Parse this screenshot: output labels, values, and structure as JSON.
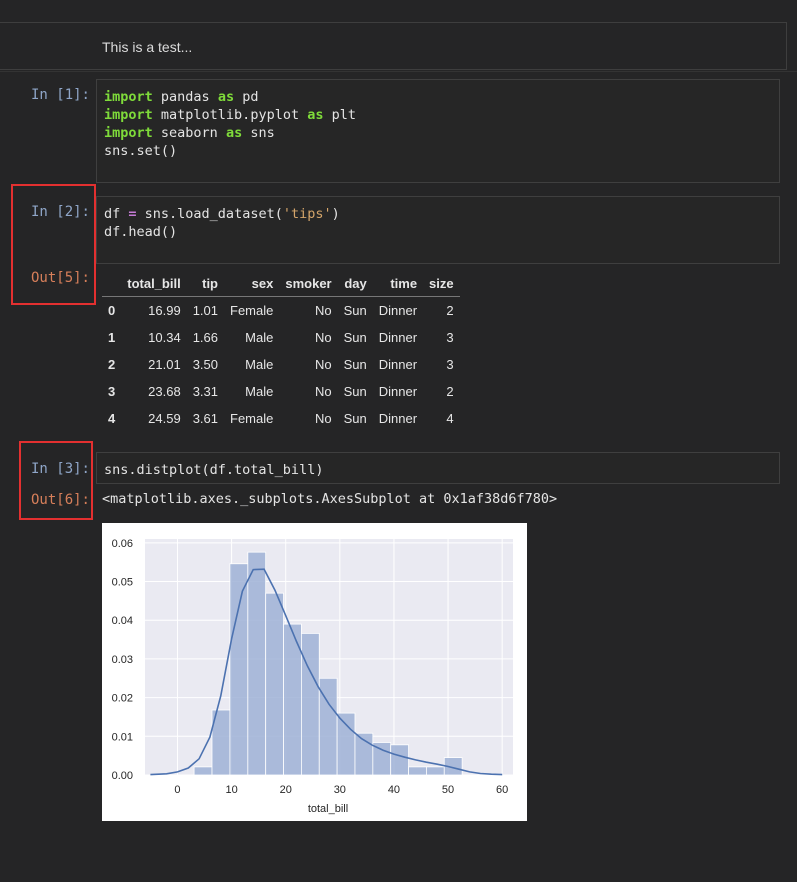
{
  "markdown": {
    "text": "This is a test..."
  },
  "cells": [
    {
      "in_prompt": "In [1]:",
      "lines": [
        [
          {
            "t": "import",
            "c": "kw"
          },
          {
            "t": " pandas "
          },
          {
            "t": "as",
            "c": "kw"
          },
          {
            "t": " pd"
          }
        ],
        [
          {
            "t": "import",
            "c": "kw"
          },
          {
            "t": " matplotlib.pyplot "
          },
          {
            "t": "as",
            "c": "kw"
          },
          {
            "t": " plt"
          }
        ],
        [
          {
            "t": "import",
            "c": "kw"
          },
          {
            "t": " seaborn "
          },
          {
            "t": "as",
            "c": "kw"
          },
          {
            "t": " sns"
          }
        ],
        [
          {
            "t": "sns.set()"
          }
        ]
      ]
    },
    {
      "in_prompt": "In [2]:",
      "out_prompt": "Out[5]:",
      "lines": [
        [
          {
            "t": "df "
          },
          {
            "t": "=",
            "c": "op"
          },
          {
            "t": " sns.load_dataset("
          },
          {
            "t": "'tips'",
            "c": "str"
          },
          {
            "t": ")"
          }
        ],
        [
          {
            "t": "df.head()"
          }
        ]
      ]
    },
    {
      "in_prompt": "In [3]:",
      "out_prompt": "Out[6]:",
      "lines": [
        [
          {
            "t": "sns.distplot(df.total_bill)"
          }
        ]
      ],
      "output_text": "<matplotlib.axes._subplots.AxesSubplot at 0x1af38d6f780>"
    }
  ],
  "dataframe": {
    "columns": [
      "",
      "total_bill",
      "tip",
      "sex",
      "smoker",
      "day",
      "time",
      "size"
    ],
    "rows": [
      [
        "0",
        "16.99",
        "1.01",
        "Female",
        "No",
        "Sun",
        "Dinner",
        "2"
      ],
      [
        "1",
        "10.34",
        "1.66",
        "Male",
        "No",
        "Sun",
        "Dinner",
        "3"
      ],
      [
        "2",
        "21.01",
        "3.50",
        "Male",
        "No",
        "Sun",
        "Dinner",
        "3"
      ],
      [
        "3",
        "23.68",
        "3.31",
        "Male",
        "No",
        "Sun",
        "Dinner",
        "2"
      ],
      [
        "4",
        "24.59",
        "3.61",
        "Female",
        "No",
        "Sun",
        "Dinner",
        "4"
      ]
    ]
  },
  "colors": {
    "highlight": "#e33030",
    "bar": "#9fb2d6",
    "kde": "#4c72b0",
    "plot_bg": "#eaeaf2"
  },
  "chart_data": {
    "type": "bar",
    "xlabel": "total_bill",
    "ylabel": "",
    "xlim": [
      -6,
      62
    ],
    "ylim": [
      0,
      0.061
    ],
    "xticks": [
      0,
      10,
      20,
      30,
      40,
      50,
      60
    ],
    "yticks": [
      0.0,
      0.01,
      0.02,
      0.03,
      0.04,
      0.05,
      0.06
    ],
    "ytick_labels": [
      "0.00",
      "0.01",
      "0.02",
      "0.03",
      "0.04",
      "0.05",
      "0.06"
    ],
    "grid": true,
    "bins": [
      {
        "x0": 3.07,
        "x1": 6.38,
        "value": 0.0021
      },
      {
        "x0": 6.38,
        "x1": 9.69,
        "value": 0.0168
      },
      {
        "x0": 9.69,
        "x1": 13.0,
        "value": 0.0546
      },
      {
        "x0": 13.0,
        "x1": 16.3,
        "value": 0.0576
      },
      {
        "x0": 16.3,
        "x1": 19.6,
        "value": 0.047
      },
      {
        "x0": 19.6,
        "x1": 22.9,
        "value": 0.039
      },
      {
        "x0": 22.9,
        "x1": 26.2,
        "value": 0.0366
      },
      {
        "x0": 26.2,
        "x1": 29.5,
        "value": 0.025
      },
      {
        "x0": 29.5,
        "x1": 32.8,
        "value": 0.016
      },
      {
        "x0": 32.8,
        "x1": 36.1,
        "value": 0.0108
      },
      {
        "x0": 36.1,
        "x1": 39.4,
        "value": 0.0084
      },
      {
        "x0": 39.4,
        "x1": 42.7,
        "value": 0.0078
      },
      {
        "x0": 42.7,
        "x1": 46.0,
        "value": 0.0021
      },
      {
        "x0": 46.0,
        "x1": 49.3,
        "value": 0.0021
      },
      {
        "x0": 49.3,
        "x1": 52.6,
        "value": 0.0045
      }
    ],
    "kde": {
      "x": [
        -5,
        -2,
        0,
        2,
        4,
        6,
        8,
        10,
        12,
        14,
        16,
        18,
        20,
        22,
        24,
        26,
        28,
        30,
        32,
        34,
        36,
        38,
        40,
        42,
        44,
        46,
        48,
        50,
        52,
        54,
        56,
        58,
        60
      ],
      "y": [
        0.0001,
        0.0003,
        0.0008,
        0.0018,
        0.0042,
        0.0098,
        0.0205,
        0.0352,
        0.0475,
        0.0531,
        0.0532,
        0.0478,
        0.0412,
        0.0345,
        0.0282,
        0.0228,
        0.0183,
        0.0147,
        0.0118,
        0.0094,
        0.0077,
        0.0064,
        0.0054,
        0.0046,
        0.0039,
        0.0033,
        0.0028,
        0.0022,
        0.0015,
        0.0008,
        0.0004,
        0.0002,
        0.0001
      ]
    }
  }
}
